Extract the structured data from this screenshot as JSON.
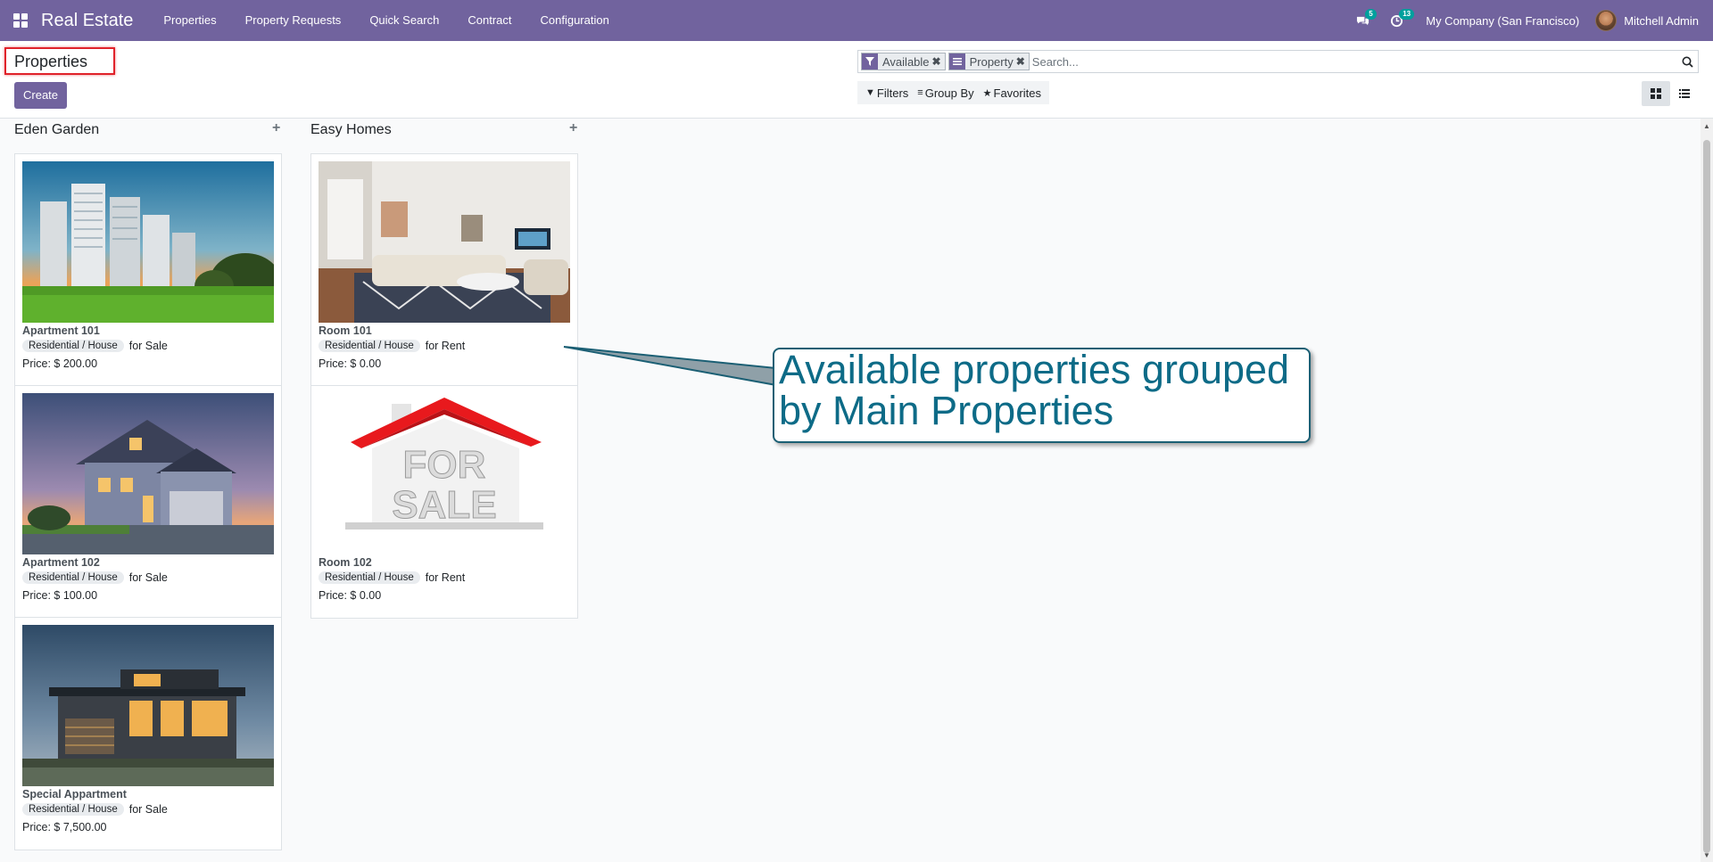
{
  "navbar": {
    "brand": "Real Estate",
    "menu": [
      "Properties",
      "Property Requests",
      "Quick Search",
      "Contract",
      "Configuration"
    ],
    "messages_badge": "5",
    "activities_badge": "13",
    "company": "My Company (San Francisco)",
    "user": "Mitchell Admin",
    "color": "#71639e"
  },
  "control_panel": {
    "breadcrumb": "Properties",
    "create_label": "Create",
    "facets": [
      {
        "label": "Available",
        "icon": "filter-icon"
      },
      {
        "label": "Property",
        "icon": "group-by-icon"
      }
    ],
    "search_placeholder": "Search...",
    "options": [
      "Filters",
      "Group By",
      "Favorites"
    ]
  },
  "kanban": {
    "columns": [
      {
        "title": "Eden Garden",
        "cards": [
          {
            "name": "Apartment 101",
            "tag": "Residential / House",
            "purpose": "for Sale",
            "price": "Price: $ 200.00",
            "image": "tower-blocks-photo"
          },
          {
            "name": "Apartment 102",
            "tag": "Residential / House",
            "purpose": "for Sale",
            "price": "Price: $ 100.00",
            "image": "suburban-house-photo"
          },
          {
            "name": "Special Appartment",
            "tag": "Residential / House",
            "purpose": "for Sale",
            "price": "Price: $ 7,500.00",
            "image": "modern-villa-photo"
          }
        ]
      },
      {
        "title": "Easy Homes",
        "cards": [
          {
            "name": "Room 101",
            "tag": "Residential / House",
            "purpose": "for Rent",
            "price": "Price: $ 0.00",
            "image": "living-room-photo"
          },
          {
            "name": "Room 102",
            "tag": "Residential / House",
            "purpose": "for Rent",
            "price": "Price: $ 0.00",
            "image": "for-sale-house-graphic"
          }
        ]
      }
    ]
  },
  "callout": {
    "line1": "Available properties grouped",
    "line2": "by Main Properties",
    "text_color": "#0d6b87"
  }
}
